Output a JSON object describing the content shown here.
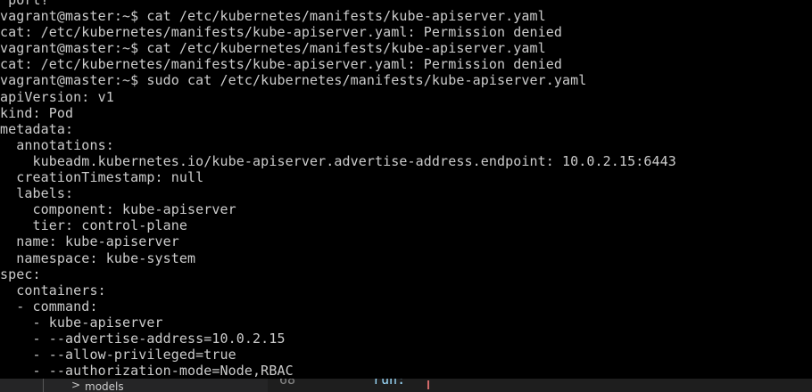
{
  "terminal": {
    "lines": [
      " port?",
      "vagrant@master:~$ cat /etc/kubernetes/manifests/kube-apiserver.yaml",
      "cat: /etc/kubernetes/manifests/kube-apiserver.yaml: Permission denied",
      "vagrant@master:~$ cat /etc/kubernetes/manifests/kube-apiserver.yaml",
      "cat: /etc/kubernetes/manifests/kube-apiserver.yaml: Permission denied",
      "vagrant@master:~$ sudo cat /etc/kubernetes/manifests/kube-apiserver.yaml",
      "apiVersion: v1",
      "kind: Pod",
      "metadata:",
      "  annotations:",
      "    kubeadm.kubernetes.io/kube-apiserver.advertise-address.endpoint: 10.0.2.15:6443",
      "  creationTimestamp: null",
      "  labels:",
      "    component: kube-apiserver",
      "    tier: control-plane",
      "  name: kube-apiserver",
      "  namespace: kube-system",
      "spec:",
      "  containers:",
      "  - command:",
      "    - kube-apiserver",
      "    - --advertise-address=10.0.2.15",
      "    - --allow-privileged=true",
      "    - --authorization-mode=Node,RBAC"
    ]
  },
  "explorer": {
    "chevron": ">",
    "folder_label": "models"
  },
  "editor": {
    "line_number": "68",
    "code_fragment": "run: "
  },
  "colors": {
    "background": "#000000",
    "text": "#cccccc"
  }
}
